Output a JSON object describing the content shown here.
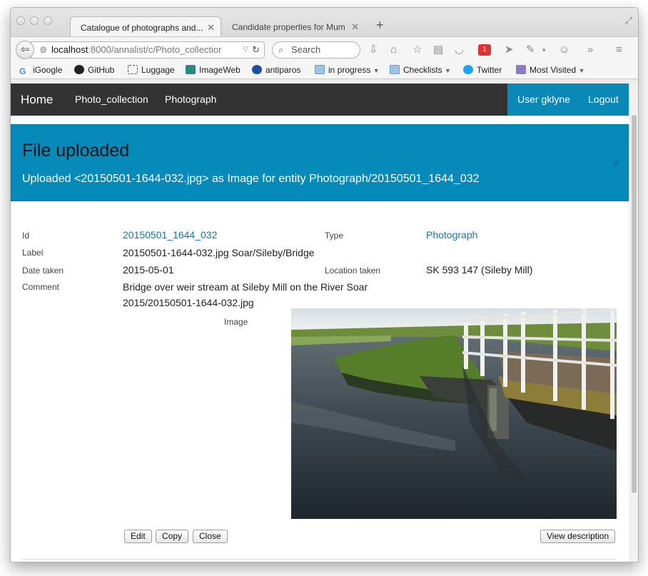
{
  "browser": {
    "tabs": [
      {
        "title": "Catalogue of photographs and..."
      },
      {
        "title": "Candidate properties for Mum"
      }
    ],
    "url_host": "localhost",
    "url_rest": ":8000/annalist/c/Photo_collectior",
    "search_placeholder": "Search",
    "extension_badge": "1",
    "bookmarks": [
      {
        "label": "iGoogle"
      },
      {
        "label": "GitHub"
      },
      {
        "label": "Luggage"
      },
      {
        "label": "ImageWeb"
      },
      {
        "label": "antiparos"
      },
      {
        "label": "in progress"
      },
      {
        "label": "Checklists"
      },
      {
        "label": "Twitter"
      },
      {
        "label": "Most Visited"
      }
    ]
  },
  "navbar": {
    "home": "Home",
    "collection": "Photo_collection",
    "type": "Photograph",
    "user": "User gklyne",
    "logout": "Logout"
  },
  "alert": {
    "title": "File uploaded",
    "message": "Uploaded <20150501-1644-032.jpg> as Image for entity Photograph/20150501_1644_032",
    "close": "×"
  },
  "entity": {
    "id_label": "Id",
    "id_value": "20150501_1644_032",
    "type_label": "Type",
    "type_value": "Photograph",
    "label_label": "Label",
    "label_value": "20150501-1644-032.jpg Soar/Sileby/Bridge",
    "date_label": "Date taken",
    "date_value": "2015-05-01",
    "location_label": "Location taken",
    "location_value": "SK 593 147 (Sileby Mill)",
    "comment_label": "Comment",
    "comment_line1": "Bridge over weir stream at Sileby Mill on the River Soar",
    "comment_line2": "2015/20150501-1644-032.jpg",
    "image_label": "Image"
  },
  "buttons": {
    "edit": "Edit",
    "copy": "Copy",
    "close": "Close",
    "view_description": "View description"
  }
}
